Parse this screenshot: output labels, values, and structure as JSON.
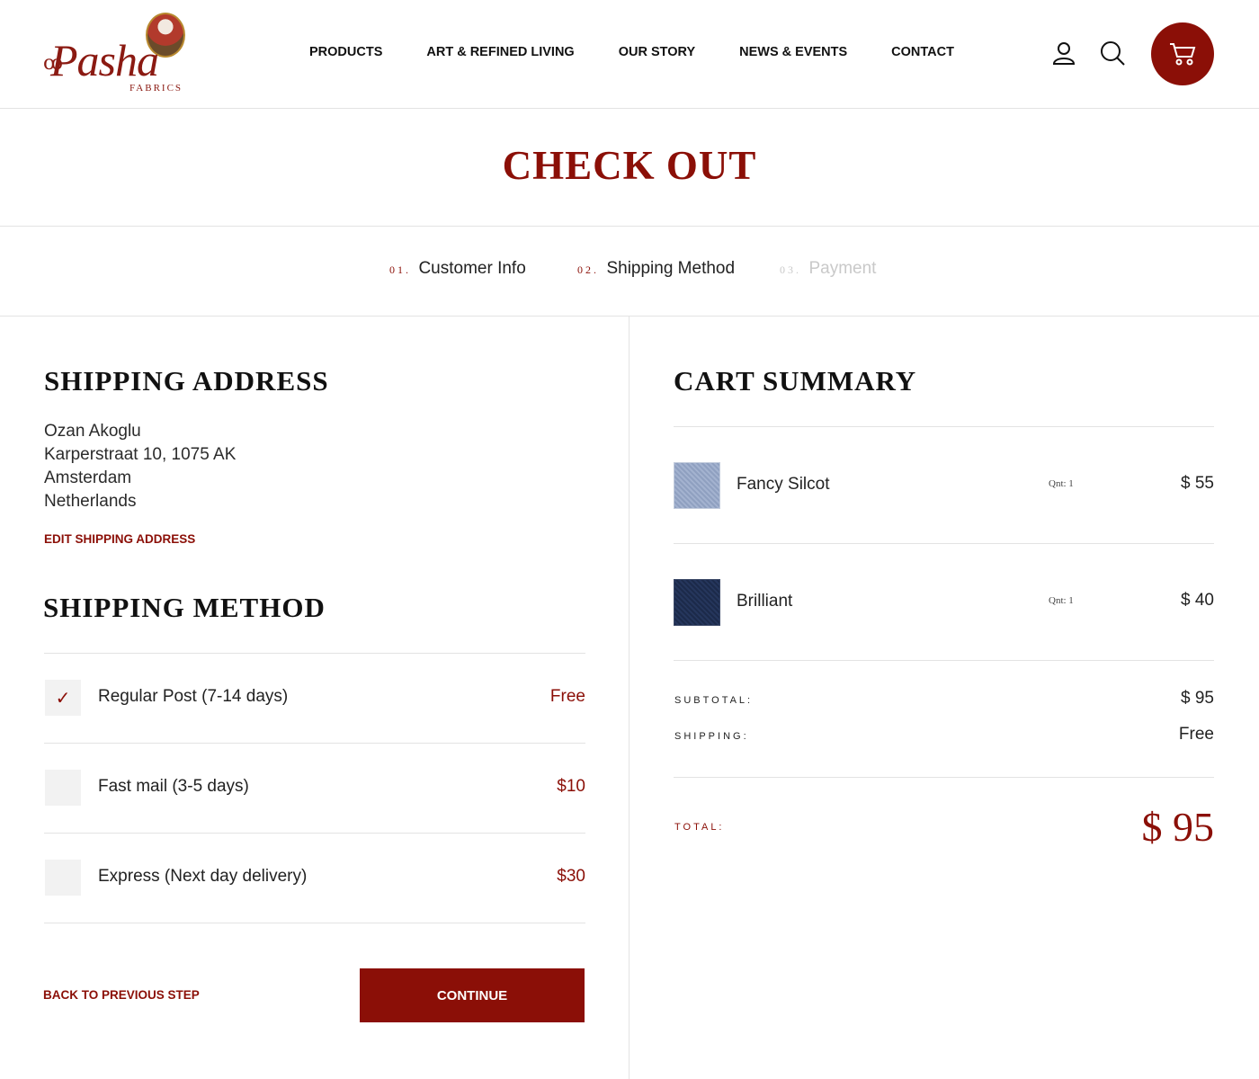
{
  "brand": {
    "logo_text": "Pasha",
    "logo_sub": "FABRICS"
  },
  "nav": {
    "items": [
      "PRODUCTS",
      "ART & REFINED LIVING",
      "OUR STORY",
      "NEWS & EVENTS",
      "CONTACT"
    ]
  },
  "header_icons": [
    "user-icon",
    "search-icon",
    "cart-icon"
  ],
  "page_title": "CHECK OUT",
  "steps": [
    {
      "num": "01.",
      "label": "Customer Info",
      "state": "done"
    },
    {
      "num": "02.",
      "label": "Shipping Method",
      "state": "active"
    },
    {
      "num": "03.",
      "label": "Payment",
      "state": "inactive"
    }
  ],
  "shipping_address": {
    "heading": "SHIPPING ADDRESS",
    "lines": [
      "Ozan Akoglu",
      "Karperstraat 10, 1075 AK",
      "Amsterdam",
      "Netherlands"
    ],
    "edit_label": "EDIT SHIPPING ADDRESS"
  },
  "shipping_method": {
    "heading": "SHIPPING METHOD",
    "options": [
      {
        "name": "Regular Post (7-14 days)",
        "price": "Free",
        "checked": true
      },
      {
        "name": "Fast mail (3-5 days)",
        "price": "$10",
        "checked": false
      },
      {
        "name": "Express (Next day delivery)",
        "price": "$30",
        "checked": false
      }
    ],
    "check_glyph": "✓"
  },
  "actions": {
    "back_label": "BACK TO PREVIOUS STEP",
    "continue_label": "CONTINUE"
  },
  "cart_summary": {
    "heading": "CART SUMMARY",
    "items": [
      {
        "name": "Fancy Silcot",
        "qty": "Qnt: 1",
        "price": "$ 55",
        "swatch_color": "#8fa0c0"
      },
      {
        "name": "Brilliant",
        "qty": "Qnt: 1",
        "price": "$ 40",
        "swatch_color": "#1c2a4a"
      }
    ],
    "subtotal_label": "SUBTOTAL:",
    "subtotal_value": "$ 95",
    "shipping_label": "SHIPPING:",
    "shipping_value": "Free",
    "total_label": "TOTAL:",
    "total_value": "$ 95"
  },
  "colors": {
    "accent": "#8b0f07",
    "divider": "#e3e3e3",
    "checkbox_bg": "#f2f2f2"
  }
}
